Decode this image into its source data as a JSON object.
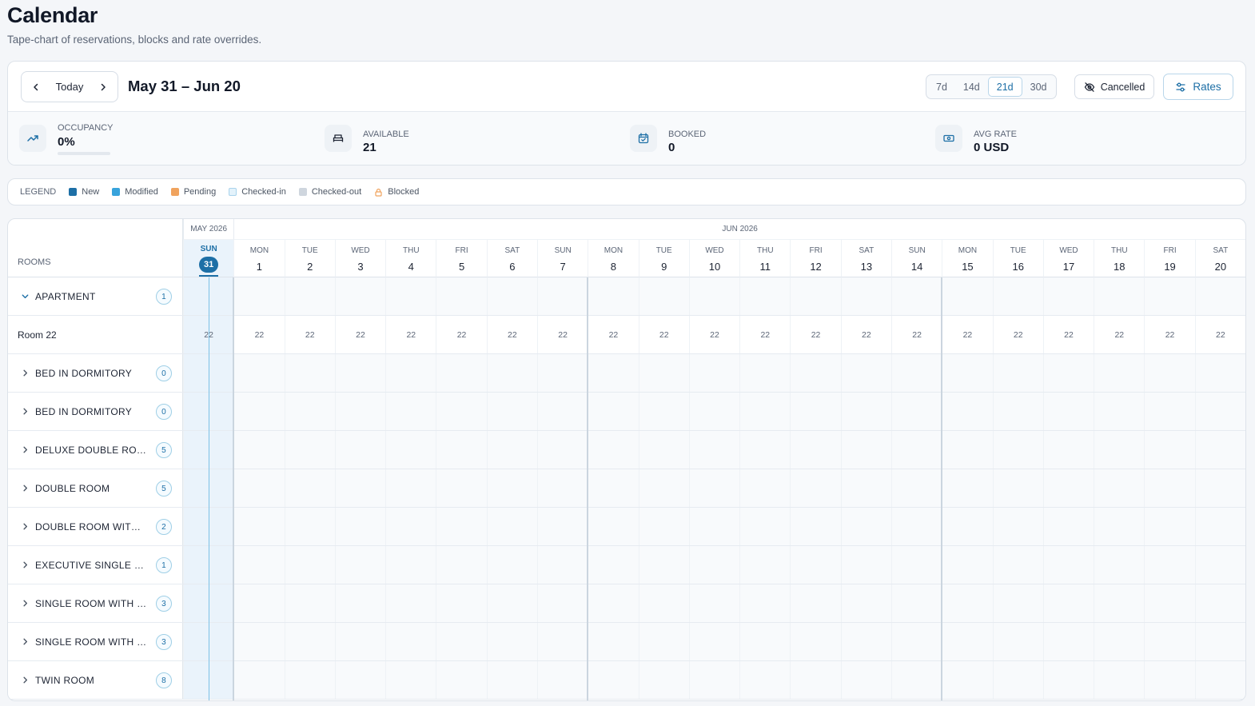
{
  "header": {
    "title": "Calendar",
    "subtitle": "Tape-chart of reservations, blocks and rate overrides."
  },
  "toolbar": {
    "today_label": "Today",
    "range_title": "May 31 – Jun 20",
    "spans": [
      "7d",
      "14d",
      "21d",
      "30d"
    ],
    "active_span": "21d",
    "cancelled_label": "Cancelled",
    "rates_label": "Rates"
  },
  "stats": {
    "occupancy": {
      "label": "OCCUPANCY",
      "value": "0%",
      "fill_fraction": 0
    },
    "available": {
      "label": "AVAILABLE",
      "value": "21"
    },
    "booked": {
      "label": "BOOKED",
      "value": "0"
    },
    "avg_rate": {
      "label": "AVG RATE",
      "value": "0 USD"
    }
  },
  "legend": {
    "title": "LEGEND",
    "items": [
      {
        "label": "New",
        "color": "#1d6fa6"
      },
      {
        "label": "Modified",
        "color": "#38a3dc"
      },
      {
        "label": "Pending",
        "color": "#f0a35e"
      },
      {
        "label": "Checked-in",
        "color": "#e3f2fb"
      },
      {
        "label": "Checked-out",
        "color": "#cfd6de"
      },
      {
        "label": "Blocked",
        "color": "#f0a35e"
      }
    ]
  },
  "calendar": {
    "rooms_header": "ROOMS",
    "months": [
      {
        "label": "MAY 2026",
        "days": 1
      },
      {
        "label": "JUN 2026",
        "days": 20
      }
    ],
    "days": [
      {
        "dow": "SUN",
        "num": "31",
        "today": true
      },
      {
        "dow": "MON",
        "num": "1"
      },
      {
        "dow": "TUE",
        "num": "2"
      },
      {
        "dow": "WED",
        "num": "3"
      },
      {
        "dow": "THU",
        "num": "4"
      },
      {
        "dow": "FRI",
        "num": "5"
      },
      {
        "dow": "SAT",
        "num": "6"
      },
      {
        "dow": "SUN",
        "num": "7"
      },
      {
        "dow": "MON",
        "num": "8"
      },
      {
        "dow": "TUE",
        "num": "9"
      },
      {
        "dow": "WED",
        "num": "10"
      },
      {
        "dow": "THU",
        "num": "11"
      },
      {
        "dow": "FRI",
        "num": "12"
      },
      {
        "dow": "SAT",
        "num": "13"
      },
      {
        "dow": "SUN",
        "num": "14"
      },
      {
        "dow": "MON",
        "num": "15"
      },
      {
        "dow": "TUE",
        "num": "16"
      },
      {
        "dow": "WED",
        "num": "17"
      },
      {
        "dow": "THU",
        "num": "18"
      },
      {
        "dow": "FRI",
        "num": "19"
      },
      {
        "dow": "SAT",
        "num": "20"
      }
    ],
    "rows": [
      {
        "type": "group",
        "name": "APARTMENT",
        "count": "1",
        "expanded": true
      },
      {
        "type": "room",
        "name": "Room 22",
        "cell_value": "22"
      },
      {
        "type": "group",
        "name": "BED IN DORMITORY",
        "count": "0"
      },
      {
        "type": "group",
        "name": "BED IN DORMITORY",
        "count": "0"
      },
      {
        "type": "group",
        "name": "DELUXE DOUBLE ROOM ...",
        "count": "5"
      },
      {
        "type": "group",
        "name": "DOUBLE ROOM",
        "count": "5"
      },
      {
        "type": "group",
        "name": "DOUBLE ROOM WITH LA...",
        "count": "2"
      },
      {
        "type": "group",
        "name": "EXECUTIVE SINGLE ROO...",
        "count": "1"
      },
      {
        "type": "group",
        "name": "SINGLE ROOM WITH CIT...",
        "count": "3"
      },
      {
        "type": "group",
        "name": "SINGLE ROOM WITH LAK...",
        "count": "3"
      },
      {
        "type": "group",
        "name": "TWIN ROOM",
        "count": "8"
      }
    ]
  }
}
